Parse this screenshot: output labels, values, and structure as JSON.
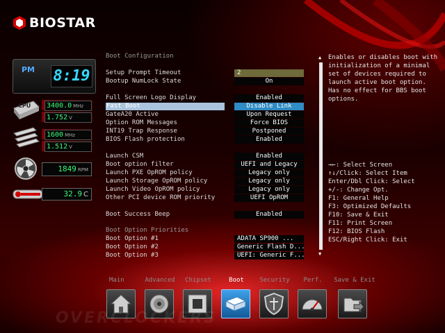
{
  "brand": {
    "name": "BIOSTAR"
  },
  "monitor": {
    "ampm": "PM",
    "time": "8:19",
    "cpu": {
      "label": "CPU",
      "frequency": "3400.0",
      "frequency_unit": "MHz",
      "voltage": "1.752",
      "voltage_unit": "V"
    },
    "memory": {
      "frequency": "1600",
      "frequency_unit": "MHz",
      "voltage": "1.512",
      "voltage_unit": "V"
    },
    "fan": {
      "speed": "1849",
      "speed_unit": "RPM"
    },
    "temperature": {
      "value": "32.9",
      "unit": "C"
    }
  },
  "menu": {
    "section_title": "Boot Configuration",
    "rows": [
      {
        "label": "Setup Prompt Timeout",
        "value": "2"
      },
      {
        "label": "Bootup NumLock State",
        "value": "On"
      },
      {
        "label": "Full Screen Logo Display",
        "value": "Enabled"
      },
      {
        "label": "Fast Boot",
        "value": "Disable Link"
      },
      {
        "label": "GateA20 Active",
        "value": "Upon Request"
      },
      {
        "label": "Option ROM Messages",
        "value": "Force BIOS"
      },
      {
        "label": "INT19 Trap Response",
        "value": "Postponed"
      },
      {
        "label": "BIOS Flash protection",
        "value": "Enabled"
      },
      {
        "label": "Launch CSM",
        "value": "Enabled"
      },
      {
        "label": "Boot option filter",
        "value": "UEFI and Legacy"
      },
      {
        "label": "Launch PXE OpROM policy",
        "value": "Legacy only"
      },
      {
        "label": "Launch Storage OpROM policy",
        "value": "Legacy only"
      },
      {
        "label": "Launch Video OpROM policy",
        "value": "Legacy only"
      },
      {
        "label": "Other PCI device ROM priority",
        "value": "UEFI OpROM"
      },
      {
        "label": "Boot Success Beep",
        "value": "Enabled"
      },
      {
        "label": "Boot Option #1",
        "value": "ADATA SP900     ..."
      },
      {
        "label": "Boot Option #2",
        "value": "Generic Flash D..."
      },
      {
        "label": "Boot Option #3",
        "value": "UEFI: Generic F..."
      }
    ],
    "priorities_title": "Boot Option Priorities"
  },
  "help": {
    "description": "Enables or disables boot with initialization of a minimal set of devices required to launch active boot option. Has no effect for BBS boot options.",
    "keys": [
      "→←: Select Screen",
      "↑↓/Click: Select Item",
      "Enter/Dbl Click: Select",
      "+/-: Change Opt.",
      "F1: General Help",
      "F3: Optimized Defaults",
      "F10: Save & Exit",
      "F11: Print Screen",
      "F12: BIOS Flash",
      "ESC/Right Click: Exit"
    ]
  },
  "tabs": [
    {
      "label": "Main",
      "icon": "home-icon"
    },
    {
      "label": "Advanced",
      "icon": "advanced-disc-icon"
    },
    {
      "label": "Chipset",
      "icon": "chipset-icon"
    },
    {
      "label": "Boot",
      "icon": "boot-drive-icon"
    },
    {
      "label": "Security",
      "icon": "security-shield-icon"
    },
    {
      "label": "Perf.",
      "icon": "performance-gauge-icon"
    },
    {
      "label": "Save & Exit",
      "icon": "save-exit-icon"
    }
  ],
  "active_tab": "Boot",
  "colors": {
    "accent": "#2f8cc4",
    "lcd_green": "#3dfc7a",
    "clock_cyan": "#35d8ff",
    "background_red": "#c00000"
  }
}
